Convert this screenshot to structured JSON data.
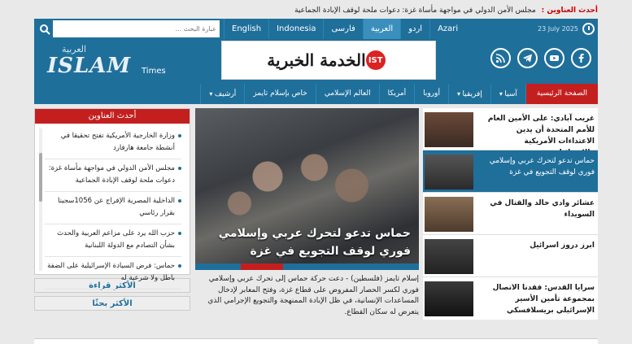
{
  "ticker": {
    "label": "أحدث العناوين :",
    "text": "مجلس الأمن الدولي في مواجهة مأساة غزة: دعوات ملحة لوقف الإبادة الجماعية"
  },
  "search": {
    "placeholder": "عبارة البحث ..."
  },
  "languages": [
    "English",
    "Indonesia",
    "فارسی",
    "العربية",
    "اردو",
    "Azari"
  ],
  "date": "23 July 2025",
  "logo": {
    "ar": "العربية",
    "en": "ISLAM",
    "times": "Times"
  },
  "banner": {
    "text": "الخدمة الخبرية",
    "badge": "IST"
  },
  "social": [
    "rss-icon",
    "telegram-icon",
    "youtube-icon",
    "facebook-icon"
  ],
  "nav": [
    "الصفحة الرئيسية",
    "آسيا",
    "إفريقيا",
    "أوروبا",
    "أمريكا",
    "العالم الإسلامي",
    "خاص بإسلام تايمز",
    "أرشيف"
  ],
  "sidebar": {
    "title": "أحدث العناوين",
    "items": [
      "وزارة الخارجية الأمريكية تفتح تحقيقا في أنشطة جامعة هارفارد",
      "مجلس الأمن الدولي في مواجهة مأساة غزة: دعوات ملحة لوقف الإبادة الجماعية",
      "الداخلية المصرية الإفراج عن 1056سجينا بقرار رئاسي",
      "حزب الله يرد على مزاعم العربية والحدث بشأن التصادم مع الدولة اللبنانية",
      "حماس: فرض السيادة الإسرائيلية على الضفة باطل ولا شرعية له"
    ],
    "most_read": "الأكثر قراءة",
    "most_searched": "الأكثر بحثًا"
  },
  "feature": {
    "caption": "حماس تدعو لتحرك عربي وإسلامي فوري لوقف التجويع في غزة",
    "summary": "إسلام تايمز (فلسطين) - دعت حركة حماس إلى تحرك عربي وإسلامي فوري لكسر الحصار المفروض على قطاع غزة، وفتح المعابر لإدخال المساعدات الإنسانية، في ظل الإبادة الممنهجة والتجويع الإجرامي الذي يتعرض له سكان القطاع."
  },
  "news_list": [
    {
      "title": "غريب آبادي: على الأمين العام للأمم المتحدة أن يدين الاعتداءات الأمريكية والإسرائيلية",
      "highlight": false
    },
    {
      "title": "حماس تدعو لتحرك عربي وإسلامي فوري لوقف التجويع في غزة",
      "highlight": true
    },
    {
      "title": "عشائر وادي خالد والقتال في السويداء",
      "highlight": false
    },
    {
      "title": "ابرز دروز اسرائيل",
      "highlight": false
    },
    {
      "title": "سرايا القدس: فقدنا الاتصال بمجموعة تأمين الأسير الإسرائيلي بريسلافسكي",
      "highlight": false
    }
  ],
  "colors": {
    "brand": "#1f6f9b",
    "accent": "#c41f1f"
  }
}
